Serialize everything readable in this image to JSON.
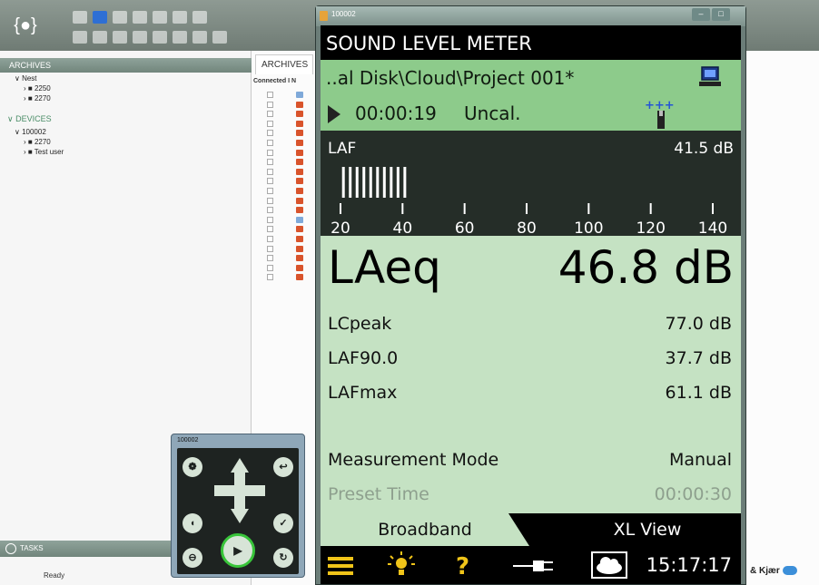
{
  "background_app": {
    "left_panel": {
      "archives_header": "ARCHIVES",
      "archive_items": [
        {
          "label": "Nest"
        },
        {
          "label": "2250"
        },
        {
          "label": "2270"
        }
      ],
      "devices_header": "DEVICES",
      "device_items": [
        {
          "label": "100002"
        },
        {
          "label": "2270"
        },
        {
          "label": "Test user"
        }
      ],
      "tasks_label": "TASKS",
      "status": "Ready"
    },
    "middle": {
      "tab_label": "ARCHIVES",
      "column_connected": "Connected",
      "column_i": "I",
      "column_n": "N"
    },
    "brand_text": "& Kjær"
  },
  "slm_window": {
    "title": "100002",
    "header": "SOUND LEVEL METER",
    "project_path": "..al Disk\\Cloud\\Project 001*",
    "elapsed_time": "00:00:19",
    "calibration_status": "Uncal.",
    "bar_parameter": "LAF",
    "bar_value": "41.5 dB",
    "bar_level_db": 41.5,
    "scale_labels": [
      "20",
      "40",
      "60",
      "80",
      "100",
      "120",
      "140"
    ],
    "main_parameter": "LAeq",
    "main_value": "46.8 dB",
    "measurements": [
      {
        "param": "LCpeak",
        "value": "77.0 dB"
      },
      {
        "param": "LAF90.0",
        "value": "37.7 dB"
      },
      {
        "param": "LAFmax",
        "value": "61.1 dB"
      }
    ],
    "mode_label": "Measurement Mode",
    "mode_value": "Manual",
    "preset_label": "Preset Time",
    "preset_value": "00:00:30",
    "tabs": [
      "Broadband",
      "XL View"
    ],
    "clock": "15:17:17"
  },
  "remote_window": {
    "title": "100002"
  },
  "colors": {
    "screen_bg": "#c5e2c3",
    "status_bg": "#8dcb8b",
    "accent_play": "#38c43a",
    "help_yellow": "#f0c419"
  }
}
